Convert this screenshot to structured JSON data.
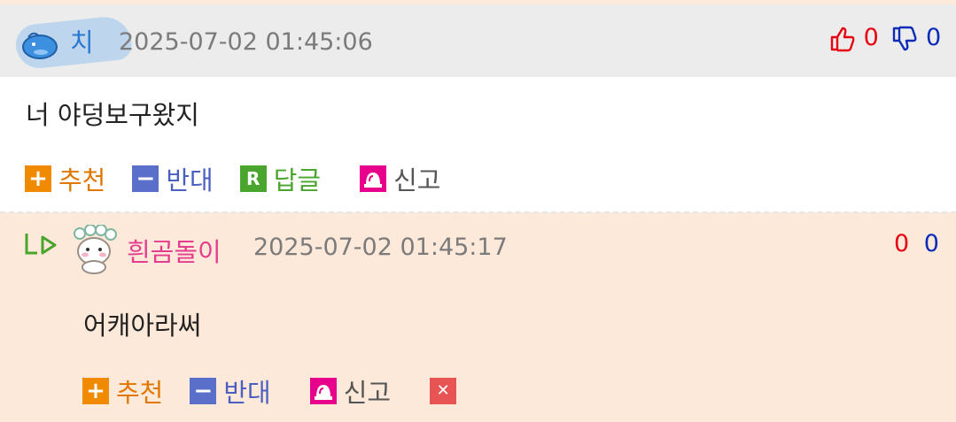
{
  "comment1": {
    "nickname": "치",
    "date": "2025-07-02 01:45:06",
    "likes": "0",
    "dislikes": "0",
    "body": "너 야덩보구왔지",
    "actions": {
      "recommend": "추천",
      "oppose": "반대",
      "reply": "답글",
      "report": "신고"
    }
  },
  "comment2": {
    "nickname": "흰곰돌이",
    "date": "2025-07-02 01:45:17",
    "likes": "0",
    "dislikes": "0",
    "body": "어캐아라써",
    "actions": {
      "recommend": "추천",
      "oppose": "반대",
      "report": "신고"
    }
  },
  "icons": {
    "plus": "+",
    "minus": "−",
    "reply": "R",
    "delete": "✕",
    "thumbs_up": "thumbs-up-icon",
    "thumbs_down": "thumbs-down-icon",
    "report": "siren-icon",
    "reply_arrow": "reply-arrow-icon"
  },
  "colors": {
    "recommend": "#f08a00",
    "oppose": "#5a6fc9",
    "reply": "#4aa52e",
    "report": "#e6008c",
    "nick1": "#2a78d0",
    "nick2": "#e43d8f",
    "like": "#e60012",
    "dislike": "#0c2bb8",
    "reply_bg": "#fde9d9",
    "header_bg": "#ececec"
  }
}
